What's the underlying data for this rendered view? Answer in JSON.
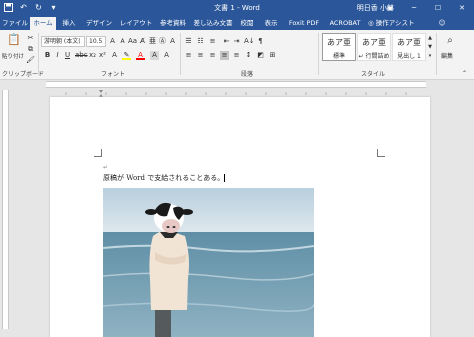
{
  "titlebar": {
    "title": "文書 1 - Word",
    "user": "明日香 小林",
    "save_icon": "save-icon",
    "undo_icon": "undo-icon",
    "redo_icon": "redo-icon",
    "customize_icon": "customize-icon"
  },
  "tabs": [
    {
      "label": "ファイル"
    },
    {
      "label": "ホーム"
    },
    {
      "label": "挿入"
    },
    {
      "label": "デザイン"
    },
    {
      "label": "レイアウト"
    },
    {
      "label": "参考資料"
    },
    {
      "label": "差し込み文書"
    },
    {
      "label": "校閲"
    },
    {
      "label": "表示"
    },
    {
      "label": "Foxit PDF"
    },
    {
      "label": "ACROBAT"
    },
    {
      "label": "操作アシスト"
    }
  ],
  "ribbon": {
    "clipboard": {
      "paste_label": "貼り付け",
      "group_label": "クリップボード"
    },
    "font": {
      "font_name": "游明朝 (本文(",
      "font_size": "10.5",
      "group_label": "フォント"
    },
    "paragraph": {
      "group_label": "段落"
    },
    "styles": {
      "group_label": "スタイル",
      "items": [
        {
          "preview": "あア亜",
          "name": "標準"
        },
        {
          "preview": "あア亜",
          "name": "↵ 行間詰め"
        },
        {
          "preview": "あア亜",
          "name": "見出し 1"
        }
      ]
    },
    "editing": {
      "label": "編集"
    }
  },
  "document": {
    "text": "原稿が Word で支給されることある。",
    "return_mark": "↵"
  },
  "colors": {
    "accent": "#2b579a",
    "highlight": "#ffff00",
    "font_color": "#ff0000"
  }
}
